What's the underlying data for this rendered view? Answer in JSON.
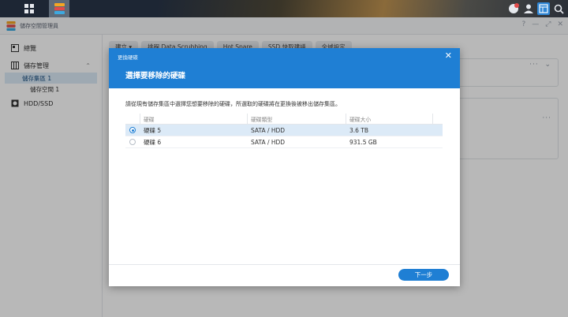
{
  "taskbar": {
    "main_menu_icon": "grid-icon",
    "active_app_icon": "storage-manager-icon",
    "right_icons": [
      "chat-notification-icon",
      "user-icon",
      "widget-icon",
      "search-icon"
    ]
  },
  "app": {
    "title": "儲存空間管理員",
    "window_controls": [
      "?",
      "—",
      "⤢",
      "✕"
    ]
  },
  "sidebar": {
    "items": [
      {
        "label": "總覽",
        "icon": "overview-icon"
      },
      {
        "label": "儲存管理",
        "icon": "storage-icon"
      },
      {
        "label": "儲存集區 1"
      },
      {
        "label": "儲存空間 1"
      },
      {
        "label": "HDD/SSD",
        "icon": "hdd-icon"
      }
    ]
  },
  "content": {
    "tabs": [
      "建立 ▾",
      "排程 Data Scrubbing",
      "Hot Spare",
      "SSD 快取建議",
      "全域設定"
    ],
    "card_ctrls": [
      "···",
      "⌄"
    ]
  },
  "modal": {
    "window_title": "更換硬碟",
    "close": "✕",
    "heading": "選擇要移除的硬碟",
    "description": "請從現有儲存集區中選擇您想要移除的硬碟，所選取的硬碟將在更換後被移出儲存集區。",
    "columns": [
      "硬碟",
      "硬碟類型",
      "硬碟大小"
    ],
    "rows": [
      {
        "name": "硬碟 5",
        "type": "SATA / HDD",
        "size": "3.6 TB",
        "selected": true
      },
      {
        "name": "硬碟 6",
        "type": "SATA / HDD",
        "size": "931.5 GB",
        "selected": false
      }
    ],
    "next_label": "下一步"
  },
  "colors": {
    "accent": "#1f7fd4",
    "selection": "#dceaf7",
    "taskbar": "#1d2634"
  }
}
